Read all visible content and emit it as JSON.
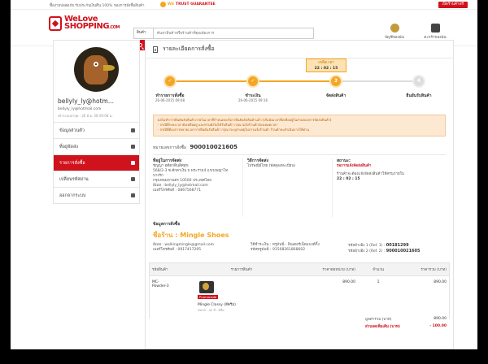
{
  "topbar": {
    "promo_text": "ซื้อง่ายปลอดภัย รับประกันเงินคืน 100% ของการสั่งซื้อสินค้า",
    "trust_we": "WE",
    "trust_guarantee": "TRUST GUARANTEE",
    "sell_button": "เปิดร้านค้าฟรี"
  },
  "header": {
    "logo_line1": "WeLove",
    "logo_line2": "SHOPPING",
    "logo_com": ".COM",
    "search_category": "สินค้า",
    "search_placeholder": "ค้นหาสินค้าหรือร้านค้าที่คุณต้องการ",
    "account_label": "บัญชีของฉัน",
    "cart_label": "ตะกร้าของฉัน"
  },
  "sidebar": {
    "username": "bellyly_ly@hotm...",
    "email": "bellyly_ly@hotmail.com",
    "last_login": "เข้าระบบล่าสุด : 26 มี.ย. 58 09:08 น.",
    "items": [
      {
        "label": "ข้อมูลส่วนตัว",
        "icon": "user-icon"
      },
      {
        "label": "ที่อยู่จัดส่ง",
        "icon": "home-icon"
      },
      {
        "label": "รายการสั่งซื้อ",
        "icon": "cart-icon"
      },
      {
        "label": "เปลี่ยนรหัสผ่าน",
        "icon": "gear-icon"
      },
      {
        "label": "ออกจากระบบ",
        "icon": "logout-icon"
      }
    ]
  },
  "main": {
    "title": "รายละเอียดการสั่งซื้อ",
    "tooltip_label": "เหลือเวลา",
    "tooltip_time": "22 : 02 : 15",
    "steps": [
      {
        "num": "✓",
        "label": "ทำรายการสั่งซื้อ",
        "time": "26-06-2015 09:08"
      },
      {
        "num": "✓",
        "label": "ชำระเงิน",
        "time": "26-06-2015 09:16"
      },
      {
        "num": "3",
        "label": "จัดส่งสินค้า",
        "time": ""
      },
      {
        "num": "4",
        "label": "ยืนยันรับสินค้า",
        "time": ""
      }
    ],
    "notice_lines": [
      "ผลไม่ทำการยืนยันรับสินค้าภายในเวลาที่กำหนดจะถือว่ายืนยันรับสินค้าแล้ว (เริ่มนับเวลาที่เหลืออยู่ในส่วนของการจัดส่งสินค้า)",
      "- กรณีที่ระยะเวลายังเหลืออยู่ และท่านยังไม่ได้รับสินค้า กรุณาแจ้งร้านค้าก่อนหมดเวลา",
      "- กรณีที่ต้องการขยายเวลาการยืนยันรับสินค้า กรุณาระบุสาเหตุในการแจ้งร้านค้า ร้านค้าจะดำเนินการให้ท่าน"
    ],
    "order_label": "หมายเลขการสั่งซื้อ",
    "order_number": "900010021605",
    "addr_head": "ที่อยู่ในการจัดส่ง",
    "addr_lines": [
      "ชัญญา อดีตกตินดิศสุข",
      "568/2-3 ซ.ศักดาเงิน ถ.พระราม4 แขวงพญาไท",
      "บางรัก",
      "กรุงเทพมหานคร 10500 ประเทศไทย",
      "อีเมล : bellyly_ly@hotmail.com",
      "เบอร์โทรศัพท์ : 0867568771"
    ],
    "ship_head": "วิธีการจัดส่ง",
    "ship_method": "ไปรษณีย์ไทย (พัสดุลงทะเบียน)",
    "status_head": "สถานะ:",
    "status_value": "รอการแจ้งจัดส่งสินค้า",
    "status_note": "ร้านค้าจะต้องแจ้งจัดส่งสินค้าให้ครบภายใน",
    "status_time": "22 : 02 : 15",
    "shop_head": "ข้อมูลการสั่งซื้อ",
    "shop_prefix": "ชื่อร้าน :",
    "shop_name": "Mingle Shoes",
    "shop_email": "อีเมล :   walkingmingle@gmail.com",
    "shop_phone": "เบอร์โทรศัพท์ :   0917417295",
    "pay_method": "วิธีชำระเงิน :   ทรูมันนี่ - อินเตอร์เน็ตแบงค์กิ้ง",
    "pay_ref": "รหัสทรูมันนี่ :   91508261868602",
    "ref1_label": "รหัสอ้างอิง 1 (Ref. 1) :",
    "ref1": "00181299",
    "ref2_label": "รหัสอ้างอิง 2 (Ref. 2) :",
    "ref2": "900010021605"
  },
  "table": {
    "headers": [
      "รหัสสินค้า",
      "รายการสินค้า",
      "ราคาต่อหน่วย (บาท)",
      "จำนวน",
      "ราคารวม (บาท)"
    ],
    "rows": [
      {
        "code": "MC-Powder-3",
        "badge": "Promocode",
        "name": "Mingle Classy (สีครีม)",
        "sub": "ขนาด : 40 สี : ครีม",
        "unit": "890.00",
        "qty": "1",
        "total": "890.00"
      }
    ]
  },
  "totals": {
    "subtotal_label": "มูลค่ารวม (บาท)",
    "subtotal": "890.00",
    "discount_label": "ส่วนลดเพิ่มเติม (บาท)",
    "discount": "- 100.00"
  }
}
